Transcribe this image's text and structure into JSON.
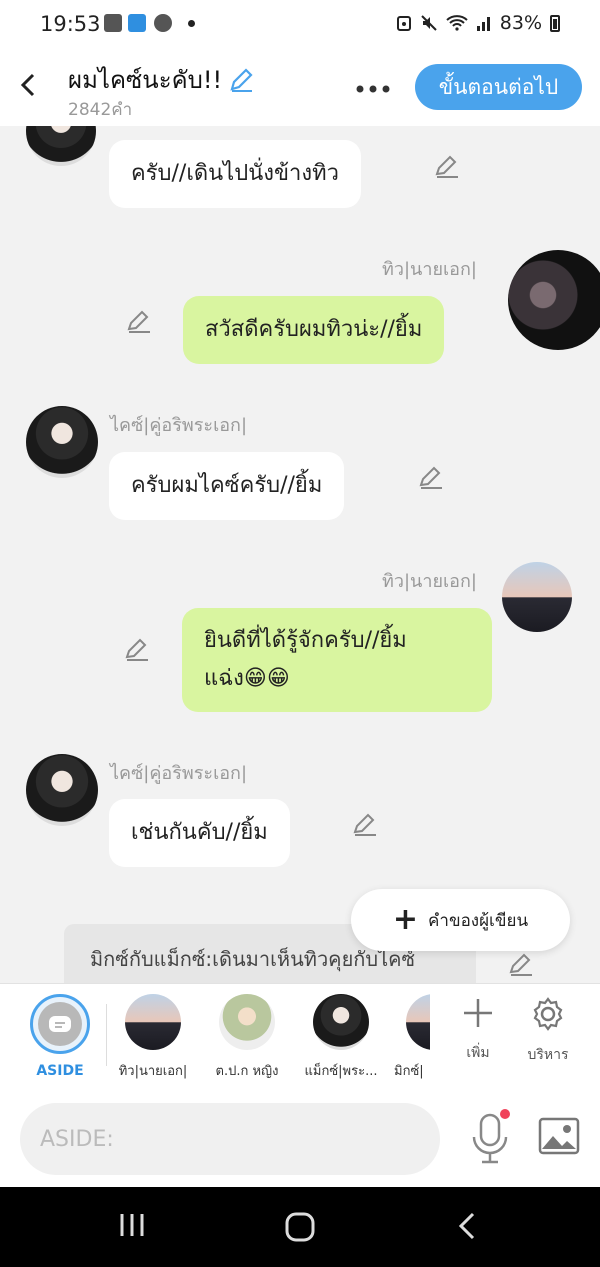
{
  "status": {
    "time": "19:53",
    "battery": "83%"
  },
  "header": {
    "title": "ผมไคซ์นะคับ!!",
    "word_count": "2842คำ",
    "next_label": "ขั้นตอนต่อไป"
  },
  "messages": [
    {
      "text": "ครับ//เดินไปนั่งข้างทิว"
    },
    {
      "name": "ทิว|นายเอก|",
      "text": "สวัสดีครับผมทิวน่ะ//ยิ้ม"
    },
    {
      "name": "ไคซ์|คู่อริพระเอก|",
      "text": "ครับผมไคซ์ครับ//ยิ้ม"
    },
    {
      "name": "ทิว|นายเอก|",
      "text_line1": "ยินดีที่ได้รู้จักครับ//ยิ้ม",
      "text_line2": "แฉ่ง😁😁"
    },
    {
      "name": "ไคซ์|คู่อริพระเอก|",
      "text": "เช่นกันคับ//ยิ้ม"
    }
  ],
  "fab": {
    "label": "คำของผู้เขียน"
  },
  "aside_note": {
    "text": "มิกซ์กับแม็กซ์:เดินมาเห็นทิวคุยกับไคซ์"
  },
  "characters": {
    "aside_label": "ASIDE",
    "items": [
      "ทิว|นายเอก|",
      "ต.ป.ก หญิง",
      "แม็กซ์|พระ...",
      "มิกซ์|"
    ],
    "add_label": "เพิ่ม",
    "manage_label": "บริหาร"
  },
  "input": {
    "placeholder": "ASIDE:"
  },
  "colors": {
    "accent": "#4aa3ec",
    "bubble_green": "#d9f5a0",
    "bubble_white": "#ffffff"
  }
}
